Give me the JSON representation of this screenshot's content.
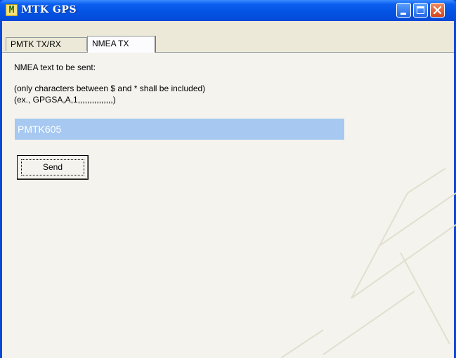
{
  "window": {
    "title": "MTK GPS",
    "icon": "app-icon-M",
    "icon_letter": "M"
  },
  "tabs": [
    {
      "label": "PMTK TX/RX",
      "active": false
    },
    {
      "label": "NMEA TX",
      "active": true
    }
  ],
  "panel": {
    "label_main": "NMEA text to be sent:",
    "hint_line1": "(only characters between $ and * shall be included)",
    "hint_line2": "(ex., GPGSA,A,1,,,,,,,,,,,,,,,)",
    "input_value": "PMTK605",
    "send_label": "Send"
  },
  "colors": {
    "titlebar": "#0453e3",
    "client_bg": "#ece9d8",
    "input_highlight": "#a6c8f1"
  }
}
